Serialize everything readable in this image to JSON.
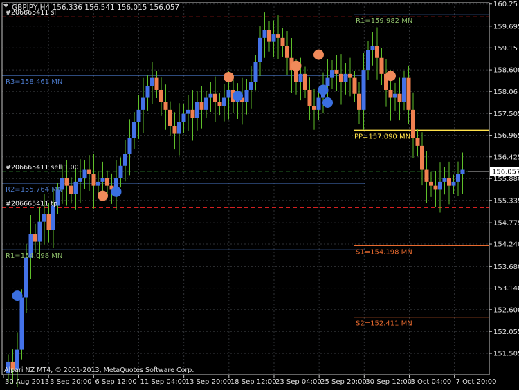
{
  "header": {
    "title": "GBPJPY,H4  156.336 156.541 156.015 156.057"
  },
  "footer": {
    "copyright": "Alpari NZ MT4, © 2001-2013, MetaQuotes Software Corp."
  },
  "colors": {
    "background": "#000000",
    "grid": "#303236",
    "axis": "#c8c8c8",
    "bull_candle": "#4472e8",
    "bear_candle": "#f08050",
    "wick": "#5fbf2a",
    "resistance": "#4a78c8",
    "pivot": "#ffe24a",
    "support": "#e86a2e",
    "order_line": "#d42020",
    "marker_buy": "#3a6fe0",
    "marker_sell": "#f08a5a"
  },
  "chart_data": {
    "type": "candlestick",
    "symbol": "GBPJPY",
    "timeframe": "H4",
    "quote": {
      "open": 156.336,
      "high": 156.541,
      "low": 156.015,
      "close": 156.057
    },
    "current_price_label": "156.057",
    "ylim": [
      150.97,
      160.28
    ],
    "y_ticks": [
      "160.25",
      "159.695",
      "159.15",
      "158.600",
      "158.06",
      "157.505",
      "156.965",
      "156.425",
      "155.880",
      "155.335",
      "154.775",
      "154.240",
      "153.680",
      "153.140",
      "152.600",
      "152.055",
      "151.505"
    ],
    "x_ticks": [
      "30 Aug 2013",
      "3 Sep 20:00",
      "6 Sep 12:00",
      "11 Sep 04:00",
      "13 Sep 20:00",
      "18 Sep 12:00",
      "23 Sep 04:00",
      "25 Sep 20:00",
      "30 Sep 12:00",
      "3 Oct 04:00",
      "7 Oct 20:00"
    ],
    "grid": true,
    "closes": [
      151.3,
      151.1,
      151.6,
      152.9,
      153.9,
      154.5,
      154.3,
      154.8,
      155.0,
      154.6,
      155.2,
      155.6,
      155.9,
      155.7,
      155.5,
      155.8,
      155.9,
      156.1,
      156.0,
      155.7,
      155.8,
      155.9,
      155.7,
      155.6,
      155.9,
      156.2,
      156.5,
      156.9,
      157.3,
      157.6,
      157.9,
      158.2,
      158.4,
      158.1,
      157.8,
      157.6,
      157.2,
      157.0,
      157.3,
      157.5,
      157.6,
      157.4,
      157.8,
      157.6,
      157.9,
      158.0,
      157.8,
      157.7,
      157.9,
      158.1,
      157.8,
      157.9,
      157.8,
      158.1,
      158.3,
      158.8,
      159.4,
      159.6,
      159.3,
      159.5,
      159.4,
      159.2,
      158.9,
      158.6,
      158.3,
      158.5,
      158.1,
      157.7,
      157.6,
      157.9,
      158.2,
      158.4,
      158.6,
      158.5,
      158.3,
      158.5,
      158.4,
      158.0,
      157.6,
      158.6,
      159.1,
      159.2,
      158.9,
      158.5,
      158.1,
      157.9,
      158.0,
      157.8,
      158.4,
      157.6,
      156.9,
      156.7,
      156.1,
      155.8,
      155.7,
      155.6,
      155.8,
      155.9,
      155.7,
      155.8,
      156.0,
      156.1
    ],
    "levels": [
      {
        "label": "R1=159.982 MN",
        "value": 159.982,
        "kind": "resistance"
      },
      {
        "label": "R3=158.461 MN",
        "value": 158.461,
        "kind": "resistance"
      },
      {
        "label": "PP=157.090 MN",
        "value": 157.09,
        "kind": "pivot"
      },
      {
        "label": "R2=155.764 MN",
        "value": 155.764,
        "kind": "resistance"
      },
      {
        "label": "R1=154.098 MN",
        "value": 154.098,
        "kind": "resistance"
      },
      {
        "label": "S1=154.198 MN",
        "value": 154.198,
        "kind": "support"
      },
      {
        "label": "S2=152.411 MN",
        "value": 152.411,
        "kind": "support"
      }
    ],
    "orders": [
      {
        "label": "#206665411 sl",
        "value": 159.93
      },
      {
        "label": "#206665411 sell 1.00",
        "value": 156.06
      },
      {
        "label": "#206665411 tp",
        "value": 155.15
      }
    ],
    "markers": [
      {
        "index": 2,
        "value": 152.95,
        "kind": "buy"
      },
      {
        "index": 21,
        "value": 155.45,
        "kind": "sell"
      },
      {
        "index": 24,
        "value": 155.55,
        "kind": "buy"
      },
      {
        "index": 49,
        "value": 158.42,
        "kind": "sell"
      },
      {
        "index": 51,
        "value": 157.95,
        "kind": "buy"
      },
      {
        "index": 64,
        "value": 158.7,
        "kind": "sell"
      },
      {
        "index": 69,
        "value": 158.98,
        "kind": "sell"
      },
      {
        "index": 70,
        "value": 158.1,
        "kind": "buy"
      },
      {
        "index": 71,
        "value": 157.78,
        "kind": "buy"
      },
      {
        "index": 85,
        "value": 158.45,
        "kind": "sell"
      }
    ]
  }
}
